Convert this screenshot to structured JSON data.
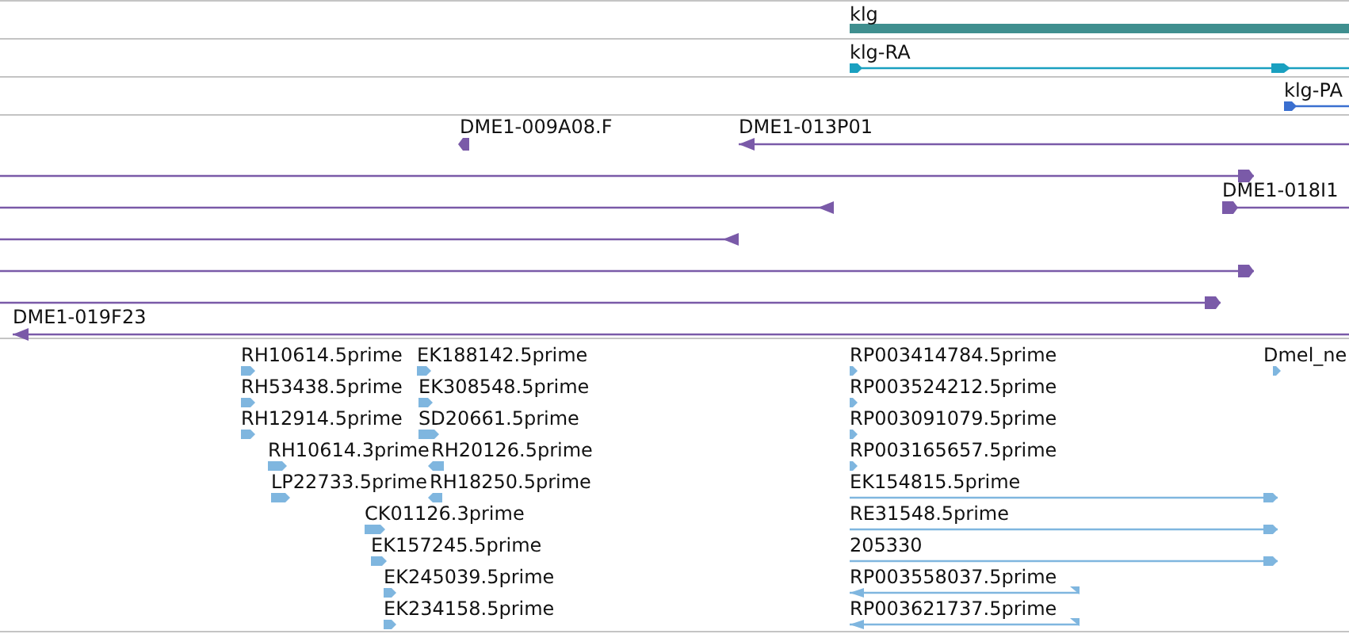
{
  "tracks": [
    {
      "kind": "gene",
      "color": "#3f8f8f",
      "features": [
        {
          "label": "klg"
        }
      ]
    },
    {
      "kind": "transcript",
      "color": "#1aa0c0",
      "features": [
        {
          "label": "klg-RA",
          "reverse": false
        }
      ]
    },
    {
      "kind": "transcript",
      "color": "#3a6fd0",
      "features": [
        {
          "label": "klg-PA",
          "reverse": false
        }
      ]
    },
    {
      "kind": "clone",
      "color": "#7a5aa8",
      "features": [
        {
          "label": "DME1-009A08.F",
          "reverse": true
        },
        {
          "label": "DME1-013P01",
          "reverse": true
        },
        {
          "reverse": false
        },
        {
          "label": "DME1-018I1",
          "reverse": false
        },
        {
          "reverse": true
        },
        {
          "reverse": true
        },
        {
          "reverse": false
        },
        {
          "reverse": false
        },
        {
          "label": "DME1-019F23",
          "reverse": true
        }
      ]
    },
    {
      "kind": "est",
      "color": "#7fb6df",
      "features": [
        {
          "label": "RH10614.5prime",
          "reverse": false
        },
        {
          "label": "EK188142.5prime",
          "reverse": false
        },
        {
          "label": "RP003414784.5prime",
          "reverse": false
        },
        {
          "label": "Dmel_ne",
          "reverse": false
        },
        {
          "label": "RH53438.5prime",
          "reverse": false
        },
        {
          "label": "EK308548.5prime",
          "reverse": false
        },
        {
          "label": "RP003524212.5prime",
          "reverse": false
        },
        {
          "label": "RH12914.5prime",
          "reverse": false
        },
        {
          "label": "SD20661.5prime",
          "reverse": false
        },
        {
          "label": "RP003091079.5prime",
          "reverse": false
        },
        {
          "label": "RH10614.3prime",
          "reverse": false
        },
        {
          "label": "RH20126.5prime",
          "reverse": true
        },
        {
          "label": "RP003165657.5prime",
          "reverse": false
        },
        {
          "label": "LP22733.5prime",
          "reverse": false
        },
        {
          "label": "RH18250.5prime",
          "reverse": true
        },
        {
          "label": "EK154815.5prime",
          "reverse": false
        },
        {
          "label": "CK01126.3prime",
          "reverse": false
        },
        {
          "label": "RE31548.5prime",
          "reverse": false
        },
        {
          "label": "EK157245.5prime",
          "reverse": false
        },
        {
          "label": "205330",
          "reverse": false
        },
        {
          "label": "EK245039.5prime",
          "reverse": false
        },
        {
          "label": "RP003558037.5prime",
          "reverse": true
        },
        {
          "label": "EK234158.5prime",
          "reverse": false
        },
        {
          "label": "RP003621737.5prime",
          "reverse": true
        }
      ]
    }
  ]
}
